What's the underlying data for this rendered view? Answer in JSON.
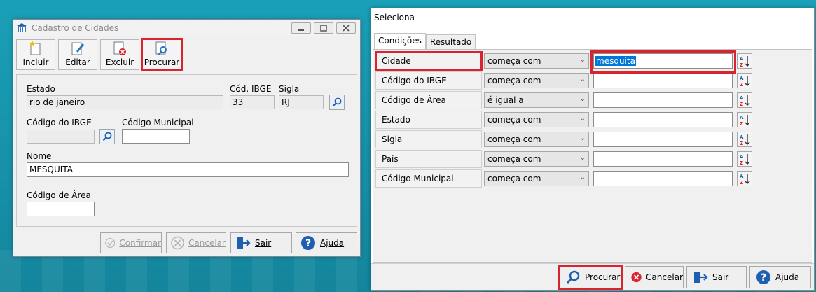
{
  "left_window": {
    "title": "Cadastro de Cidades",
    "toolbar": {
      "incluir": "Incluir",
      "editar": "Editar",
      "excluir": "Excluir",
      "procurar": "Procurar"
    },
    "fields": {
      "estado_label": "Estado",
      "estado_value": "rio de janeiro",
      "cod_ibge_label": "Cód. IBGE",
      "cod_ibge_value": "33",
      "sigla_label": "Sigla",
      "sigla_value": "RJ",
      "codigo_ibge_label": "Código do IBGE",
      "codigo_ibge_value": "",
      "codigo_municipal_label": "Código Municipal",
      "codigo_municipal_value": "",
      "nome_label": "Nome",
      "nome_value": "MESQUITA",
      "codigo_area_label": "Código de Área",
      "codigo_area_value": ""
    },
    "footer": {
      "confirmar": "Confirmar",
      "cancelar": "Cancelar",
      "sair": "Sair",
      "ajuda": "Ajuda"
    }
  },
  "right_window": {
    "title": "Seleciona",
    "tabs": [
      "Condições",
      "Resultado"
    ],
    "conditions": [
      {
        "field": "Cidade",
        "operator": "começa com",
        "value": "mesquita"
      },
      {
        "field": "Código do IBGE",
        "operator": "começa com",
        "value": ""
      },
      {
        "field": "Código de Área",
        "operator": "é igual a",
        "value": ""
      },
      {
        "field": "Estado",
        "operator": "começa com",
        "value": ""
      },
      {
        "field": "Sigla",
        "operator": "começa com",
        "value": ""
      },
      {
        "field": "País",
        "operator": "começa com",
        "value": ""
      },
      {
        "field": "Código Municipal",
        "operator": "começa com",
        "value": ""
      }
    ],
    "footer": {
      "procurar": "Procurar",
      "cancelar": "Cancelar",
      "sair": "Sair",
      "ajuda": "Ajuda"
    }
  },
  "colors": {
    "highlight_red": "#d9232e",
    "selection_blue": "#0078d7",
    "desktop_teal": "#1791a8"
  }
}
